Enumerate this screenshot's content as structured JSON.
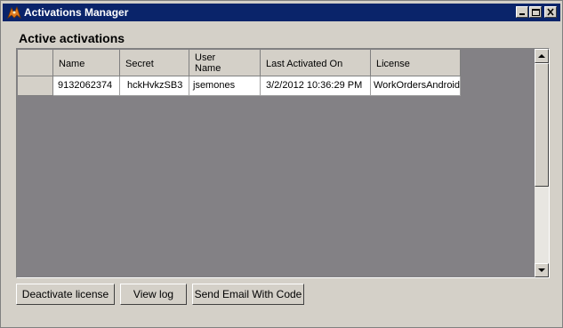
{
  "window": {
    "title": "Activations Manager",
    "caption_buttons": [
      "minimize-icon",
      "maximize-icon",
      "close-icon"
    ]
  },
  "section_label": "Active activations",
  "grid": {
    "columns": [
      {
        "id": "name",
        "label": "Name"
      },
      {
        "id": "secret",
        "label": "Secret"
      },
      {
        "id": "user_name",
        "label": "User\nName"
      },
      {
        "id": "last_activated",
        "label": "Last Activated On"
      },
      {
        "id": "license",
        "label": "License"
      }
    ],
    "rows": [
      {
        "name": "9132062374",
        "secret": "hckHvkzSB3",
        "user_name": "jsemones",
        "last_activated": "3/2/2012 10:36:29 PM",
        "license": "WorkOrdersAndroid"
      }
    ]
  },
  "buttons": {
    "deactivate": "Deactivate license",
    "view_log": "View log",
    "send_email": "Send Email With Code"
  },
  "colors": {
    "titlebar": "#0a246a",
    "grid_background": "#838185",
    "face": "#d4d0c8"
  }
}
